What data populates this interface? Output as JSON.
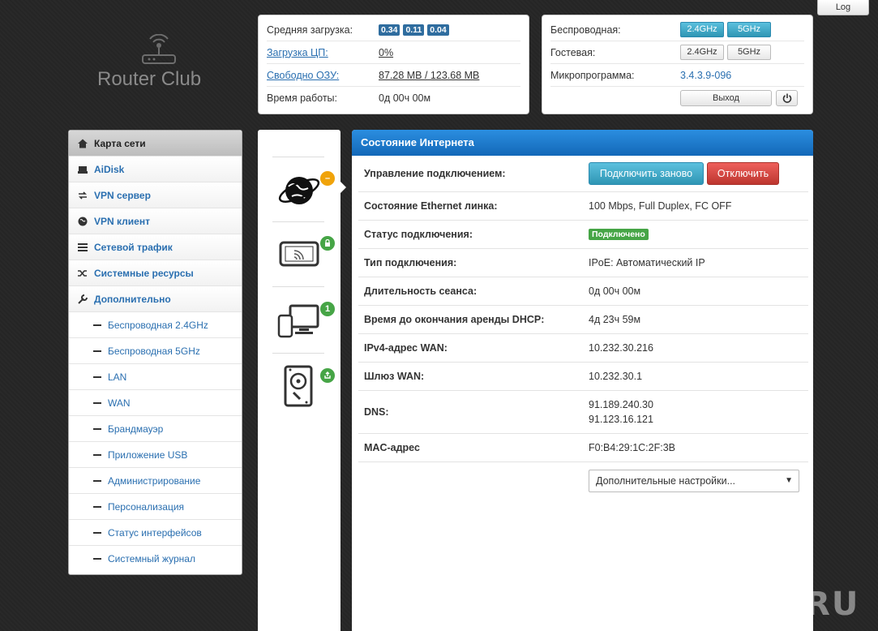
{
  "top": {
    "log_label": "Log"
  },
  "logo": {
    "text": "Router Club"
  },
  "status_left": {
    "load_label": "Средняя загрузка:",
    "load_values": [
      "0.34",
      "0.11",
      "0.04"
    ],
    "cpu_label": "Загрузка ЦП:",
    "cpu_value": "0%",
    "ram_label": "Свободно ОЗУ:",
    "ram_value": "87.28 MB / 123.68 MB",
    "uptime_label": "Время работы:",
    "uptime_value": "0д 00ч 00м"
  },
  "status_right": {
    "wireless_label": "Беспроводная:",
    "guest_label": "Гостевая:",
    "band_24": "2.4GHz",
    "band_5": "5GHz",
    "firmware_label": "Микропрограмма:",
    "firmware_value": "3.4.3.9-096",
    "logout_label": "Выход"
  },
  "nav": {
    "items": [
      {
        "label": "Карта сети",
        "icon": "home-icon"
      },
      {
        "label": "AiDisk",
        "icon": "disk-icon"
      },
      {
        "label": "VPN сервер",
        "icon": "vpn-server-icon"
      },
      {
        "label": "VPN клиент",
        "icon": "globe-icon"
      },
      {
        "label": "Сетевой трафик",
        "icon": "list-icon"
      },
      {
        "label": "Системные ресурсы",
        "icon": "shuffle-icon"
      },
      {
        "label": "Дополнительно",
        "icon": "wrench-icon"
      }
    ],
    "sub": [
      "Беспроводная 2.4GHz",
      "Беспроводная 5GHz",
      "LAN",
      "WAN",
      "Брандмауэр",
      "Приложение USB",
      "Администрирование",
      "Персонализация",
      "Статус интерфейсов",
      "Системный журнал"
    ]
  },
  "icons": {
    "lan_count": "1",
    "colors": {
      "warning": "#f0a30a",
      "ok": "#46a546"
    }
  },
  "main": {
    "title": "Состояние Интернета",
    "conn_control_label": "Управление подключением:",
    "reconnect_label": "Подключить заново",
    "disconnect_label": "Отключить",
    "eth_label": "Состояние Ethernet линка:",
    "eth_value": "100 Mbps, Full Duplex, FC OFF",
    "status_label": "Статус подключения:",
    "status_value": "Подключено",
    "type_label": "Тип подключения:",
    "type_value": "IPoE: Автоматический IP",
    "session_label": "Длительность сеанса:",
    "session_value": "0д 00ч 00м",
    "lease_label": "Время до окончания аренды DHCP:",
    "lease_value": "4д 23ч 59м",
    "wan_ip_label": "IPv4-адрес WAN:",
    "wan_ip_value": "10.232.30.216",
    "gw_label": "Шлюз WAN:",
    "gw_value": "10.232.30.1",
    "dns_label": "DNS:",
    "dns_1": "91.189.240.30",
    "dns_2": "91.123.16.121",
    "mac_label": "MAC-адрес",
    "mac_value": "F0:B4:29:1C:2F:3B",
    "more_settings": "Дополнительные настройки..."
  },
  "watermark": "WIFIKA.RU"
}
